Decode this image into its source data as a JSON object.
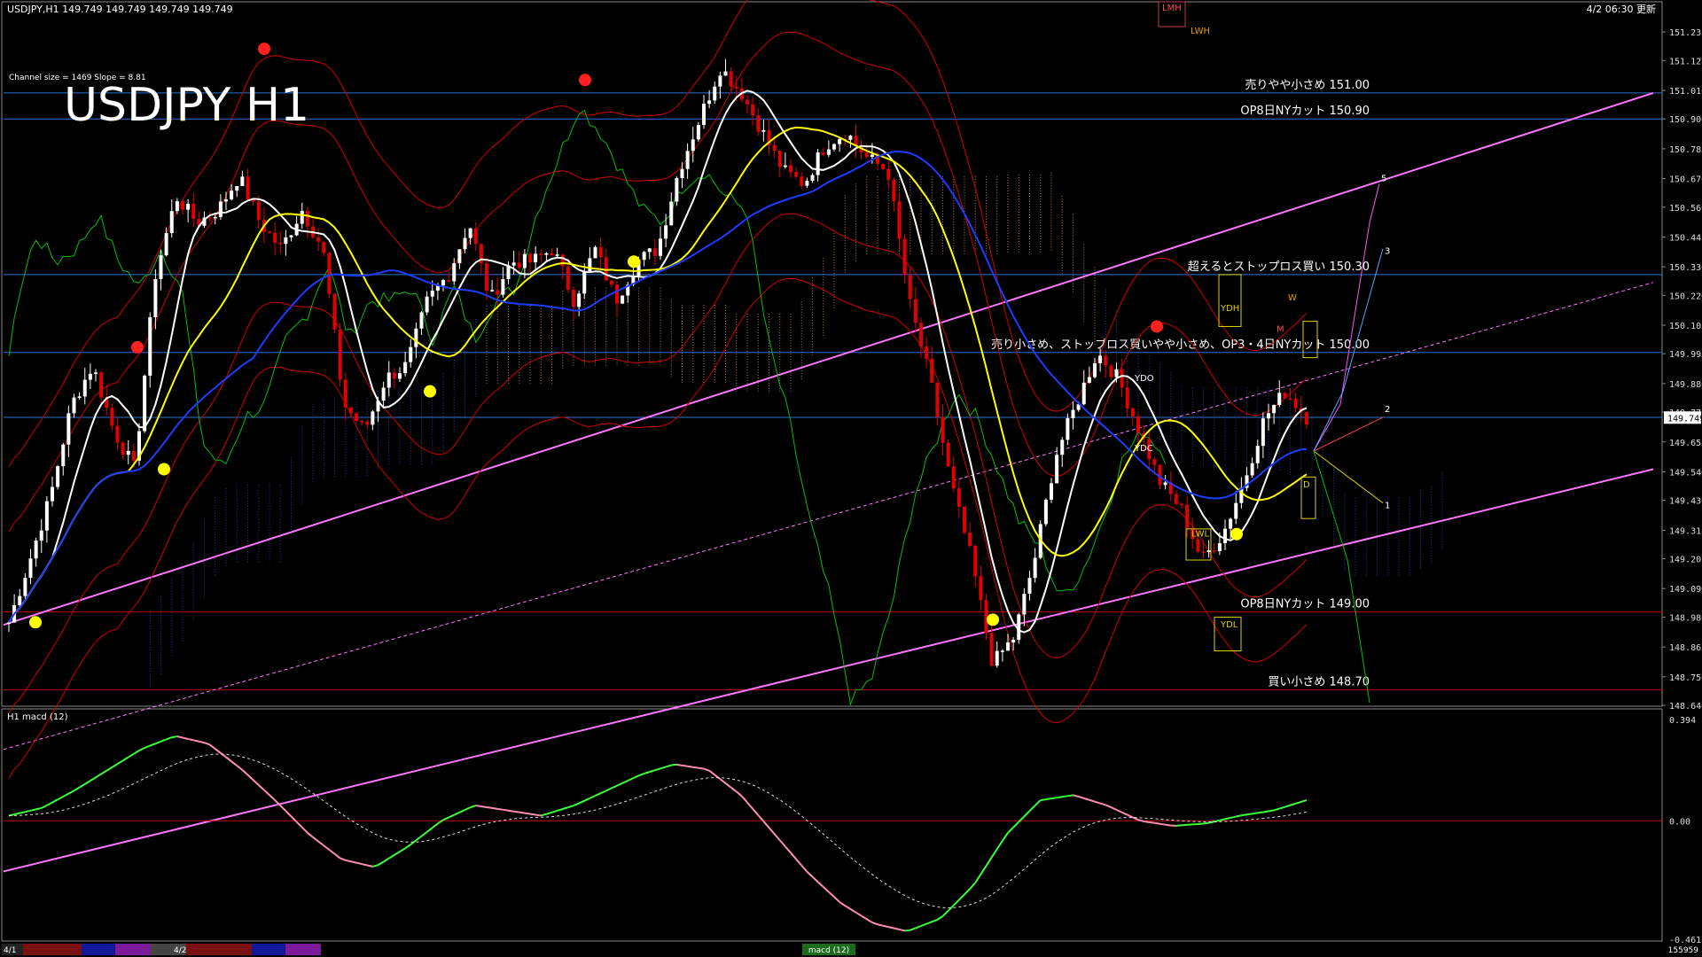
{
  "header": {
    "symbol_line": "USDJPY,H1  149.749 149.749 149.749 149.749",
    "updated": "4/2 06:30 更新",
    "channel_info": "Channel size = 1469 Slope = 8.81",
    "big_title": "USDJPY H1"
  },
  "chart_data": [
    {
      "type": "candlestick",
      "title": "USDJPY H1",
      "ylim": [
        148.64,
        151.29
      ],
      "y_ticks": [
        "151.235",
        "151.125",
        "151.010",
        "150.900",
        "150.785",
        "150.670",
        "150.560",
        "150.445",
        "150.330",
        "150.220",
        "150.105",
        "149.995",
        "149.880",
        "149.770",
        "149.655",
        "149.540",
        "149.430",
        "149.315",
        "149.205",
        "149.090",
        "148.980",
        "148.865",
        "148.750",
        "148.640"
      ],
      "current_price": "149.749",
      "close_path": [
        148.96,
        149.2,
        149.45,
        149.8,
        149.95,
        149.7,
        149.55,
        150.3,
        150.6,
        150.5,
        150.55,
        150.68,
        150.5,
        150.4,
        150.55,
        150.4,
        149.8,
        149.7,
        149.9,
        149.95,
        150.2,
        150.3,
        150.5,
        150.2,
        150.35,
        150.35,
        150.4,
        150.2,
        150.4,
        150.2,
        150.35,
        150.4,
        150.7,
        150.9,
        151.1,
        151.0,
        150.85,
        150.7,
        150.65,
        150.8,
        150.85,
        150.75,
        150.7,
        150.2,
        149.9,
        149.5,
        149.2,
        148.8,
        148.9,
        149.2,
        149.6,
        149.8,
        150.0,
        149.9,
        149.7,
        149.5,
        149.4,
        149.2,
        149.3,
        149.5,
        149.75,
        149.85,
        149.75
      ],
      "price_levels": [
        {
          "price": 151.0,
          "label": "売りやや小さめ 151.00",
          "color": "#2e6fd6"
        },
        {
          "price": 150.9,
          "label": "OP8日NYカット 150.90",
          "color": "#2e6fd6"
        },
        {
          "price": 150.3,
          "label": "超えるとストップロス買い 150.30",
          "color": "#2e6fd6"
        },
        {
          "price": 150.0,
          "label": "売り小さめ、ストップロス買いやや小さめ、OP3・4日NYカット 150.00",
          "color": "#2e6fd6"
        },
        {
          "price": 149.75,
          "label": "",
          "color": "#2e6fd6"
        },
        {
          "price": 149.0,
          "label": "OP8日NYカット 149.00",
          "color": "#c00000"
        },
        {
          "price": 148.7,
          "label": "買い小さめ 148.70",
          "color": "#c00000"
        }
      ],
      "wave_labels": [
        "5",
        "3",
        "2",
        "1"
      ],
      "box_labels": {
        "lmh": "LMH",
        "lwh": "LWH",
        "ydh": "YDH",
        "ydo": "YDO",
        "ydc": "YDC",
        "ydl": "YDL",
        "lwl": "LWL",
        "w": "W",
        "m": "M",
        "d": "D"
      },
      "colors": {
        "bull": "#ffffff",
        "bear": "#e00000",
        "ma_fast": "#ffffff",
        "ma_mid": "#ffff00",
        "ma_slow": "#1e3cff",
        "band": "#d00000",
        "lagging": "#00c000",
        "channel": "#ff77ff",
        "cloud": "#2d46d6",
        "cloud_bear": "#d9a066",
        "yellow_box": "#e0d000"
      }
    },
    {
      "type": "line",
      "title": "H1  macd (12)",
      "ylim": [
        -0.461,
        0.394
      ],
      "y_ticks": [
        "0.394",
        "0.00",
        "-0.461"
      ],
      "macd_path": [
        0.02,
        0.05,
        0.12,
        0.2,
        0.28,
        0.33,
        0.3,
        0.2,
        0.08,
        -0.05,
        -0.15,
        -0.18,
        -0.1,
        0.0,
        0.06,
        0.04,
        0.02,
        0.06,
        0.12,
        0.18,
        0.22,
        0.2,
        0.1,
        -0.05,
        -0.2,
        -0.32,
        -0.4,
        -0.43,
        -0.38,
        -0.25,
        -0.05,
        0.08,
        0.1,
        0.06,
        0.0,
        -0.02,
        -0.01,
        0.02,
        0.04,
        0.08
      ],
      "colors": {
        "up": "#3cff3c",
        "down": "#ff8fb0",
        "signal": "#dddddd",
        "zero": "#c00000"
      }
    }
  ],
  "footer": {
    "date_tabs": [
      "4/1",
      "4/2"
    ],
    "center_label": "macd (12)",
    "right_value": "155959"
  }
}
